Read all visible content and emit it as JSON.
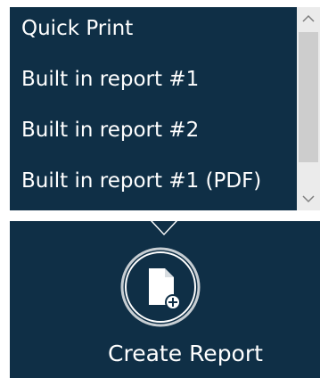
{
  "menu": {
    "items": [
      {
        "label": "Quick Print"
      },
      {
        "label": "Built in report #1"
      },
      {
        "label": "Built in report #2"
      },
      {
        "label": "Built in report #1 (PDF)"
      }
    ]
  },
  "scrollbar": {
    "up_icon": "chevron-up-icon",
    "down_icon": "chevron-down-icon"
  },
  "report_button": {
    "label": "Create Report",
    "icon": "new-document-icon"
  },
  "colors": {
    "panel_bg": "#0f2f46",
    "text": "#ffffff",
    "scroll_track": "#ebebeb",
    "scroll_thumb": "#cdcdcd"
  }
}
